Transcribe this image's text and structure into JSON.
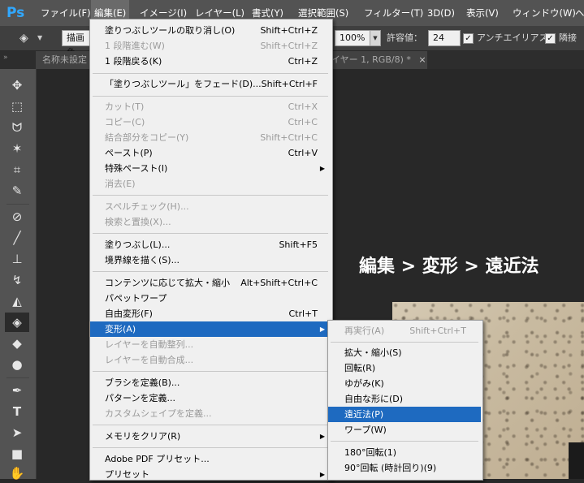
{
  "app": {
    "logo": "Ps"
  },
  "menubar": {
    "items": [
      "ファイル(F)",
      "編集(E)",
      "イメージ(I)",
      "レイヤー(L)",
      "書式(Y)",
      "選択範囲(S)",
      "フィルター(T)",
      "3D(D)",
      "表示(V)",
      "ウィンドウ(W)",
      "ヘ"
    ]
  },
  "options": {
    "fill_mode": "描画色",
    "opacity_value": "100%",
    "tolerance_label": "許容値：",
    "tolerance_value": "24",
    "antialias_label": "アンチエイリアス",
    "contiguous_label": "隣接"
  },
  "tabs": {
    "left": "名称未設定",
    "right": "イヤー 1, RGB/8) *",
    "close": "×"
  },
  "caption": "編集 > 変形 > 遠近法",
  "edit_menu": {
    "items": [
      {
        "label": "塗りつぶしツールの取り消し(O)",
        "shortcut": "Shift+Ctrl+Z"
      },
      {
        "label": "1 段階進む(W)",
        "shortcut": "Shift+Ctrl+Z"
      },
      {
        "label": "1 段階戻る(K)",
        "shortcut": "Ctrl+Z"
      },
      {
        "label": "「塗りつぶしツール」をフェード(D)...",
        "shortcut": "Shift+Ctrl+F"
      },
      {
        "label": "カット(T)",
        "shortcut": "Ctrl+X"
      },
      {
        "label": "コピー(C)",
        "shortcut": "Ctrl+C"
      },
      {
        "label": "結合部分をコピー(Y)",
        "shortcut": "Shift+Ctrl+C"
      },
      {
        "label": "ペースト(P)",
        "shortcut": "Ctrl+V"
      },
      {
        "label": "特殊ペースト(I)",
        "shortcut": ""
      },
      {
        "label": "消去(E)",
        "shortcut": ""
      },
      {
        "label": "スペルチェック(H)...",
        "shortcut": ""
      },
      {
        "label": "検索と置換(X)...",
        "shortcut": ""
      },
      {
        "label": "塗りつぶし(L)...",
        "shortcut": "Shift+F5"
      },
      {
        "label": "境界線を描く(S)...",
        "shortcut": ""
      },
      {
        "label": "コンテンツに応じて拡大・縮小",
        "shortcut": "Alt+Shift+Ctrl+C"
      },
      {
        "label": "パペットワープ",
        "shortcut": ""
      },
      {
        "label": "自由変形(F)",
        "shortcut": "Ctrl+T"
      },
      {
        "label": "変形(A)",
        "shortcut": ""
      },
      {
        "label": "レイヤーを自動整列...",
        "shortcut": ""
      },
      {
        "label": "レイヤーを自動合成...",
        "shortcut": ""
      },
      {
        "label": "ブラシを定義(B)...",
        "shortcut": ""
      },
      {
        "label": "パターンを定義...",
        "shortcut": ""
      },
      {
        "label": "カスタムシェイプを定義...",
        "shortcut": ""
      },
      {
        "label": "メモリをクリア(R)",
        "shortcut": ""
      },
      {
        "label": "Adobe PDF プリセット...",
        "shortcut": ""
      },
      {
        "label": "プリセット",
        "shortcut": ""
      }
    ],
    "arrow": "▶"
  },
  "transform_menu": {
    "items": [
      {
        "label": "再実行(A)",
        "shortcut": "Shift+Ctrl+T"
      },
      {
        "label": "拡大・縮小(S)",
        "shortcut": ""
      },
      {
        "label": "回転(R)",
        "shortcut": ""
      },
      {
        "label": "ゆがみ(K)",
        "shortcut": ""
      },
      {
        "label": "自由な形に(D)",
        "shortcut": ""
      },
      {
        "label": "遠近法(P)",
        "shortcut": ""
      },
      {
        "label": "ワープ(W)",
        "shortcut": ""
      },
      {
        "label": "180°回転(1)",
        "shortcut": ""
      },
      {
        "label": "90°回転 (時計回り)(9)",
        "shortcut": ""
      }
    ]
  },
  "colors": {
    "highlight": "#1e6ac0",
    "menu_bg": "#f0f0f0",
    "logo": "#31a8ff"
  },
  "icons": [
    "move-icon",
    "marquee-icon",
    "lasso-icon",
    "magic-wand-icon",
    "crop-icon",
    "eyedropper-icon",
    "healing-brush-icon",
    "brush-icon",
    "clone-stamp-icon",
    "history-brush-icon",
    "eraser-icon",
    "paint-bucket-icon",
    "blur-icon",
    "dodge-icon",
    "pen-icon",
    "type-icon",
    "path-selection-icon",
    "rectangle-icon",
    "hand-icon"
  ]
}
